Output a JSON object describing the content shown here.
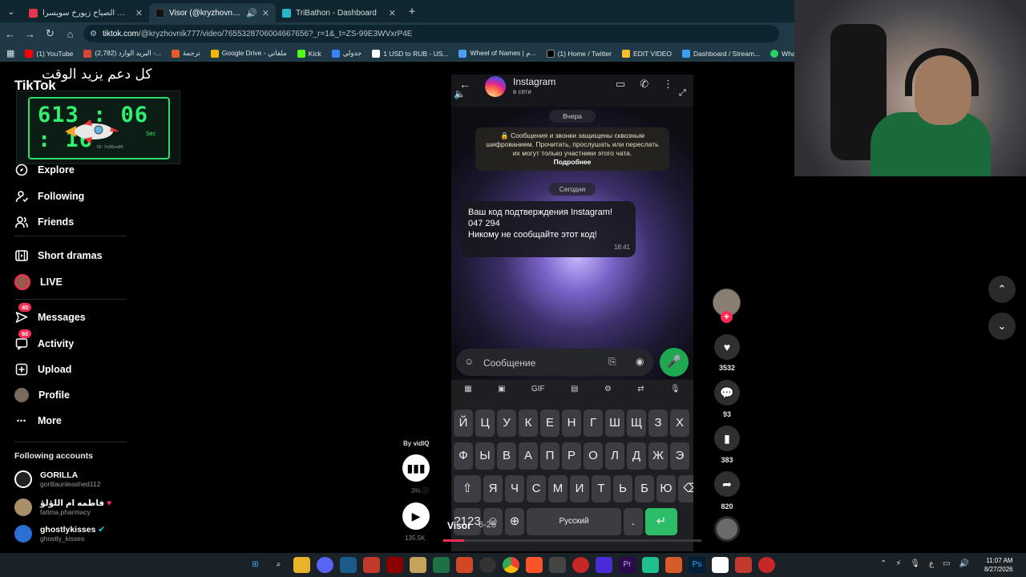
{
  "browser": {
    "tabs": [
      {
        "title": "فيروزيات الصباح زيورخ سويسرا ...",
        "active": false,
        "color": "#e8344e"
      },
      {
        "title": "Visor (@kryzhovnik777)'s vi...",
        "active": true,
        "color": "#111111"
      },
      {
        "title": "TriBathon - Dashboard",
        "active": false,
        "color": "#2ab6c9"
      }
    ],
    "url_host": "tiktok.com",
    "url_path": "/@kryzhovnik777/video/7655328706004667656?_r=1&_t=ZS-99E3WVxrP4E",
    "bookmarks": [
      {
        "label": "(1) YouTube",
        "color": "#ff0000"
      },
      {
        "label": "(2,782) البريد الوارد -...",
        "color": "#d44638"
      },
      {
        "label": "ترجمة",
        "color": "#e85a2a"
      },
      {
        "label": "Google Drive - ملفاتي",
        "color": "#f5b800"
      },
      {
        "label": "Kick",
        "color": "#53fc18"
      },
      {
        "label": "جدولي",
        "color": "#3b82f6"
      },
      {
        "label": "1 USD to RUB - US...",
        "color": "#ffffff"
      },
      {
        "label": "Wheel of Names | م...",
        "color": "#4c9cf1"
      },
      {
        "label": "(1) Home / Twitter",
        "color": "#000000"
      },
      {
        "label": "EDIT VIDEO",
        "color": "#f7c02b"
      },
      {
        "label": "Dashboard / Stream...",
        "color": "#3aa0f0"
      },
      {
        "label": "WhatsApp",
        "color": "#25d366"
      },
      {
        "label": "D",
        "color": "#3a5bd9"
      }
    ]
  },
  "sidebar": {
    "logo": "TikTok",
    "overlay_text": "كل دعم يزيد الوقت",
    "timer": {
      "value": "613 : 06 : 16",
      "sec_label": "Sec",
      "sub": "ID: 7e36ce86",
      "badge": "LIVE"
    },
    "items": [
      {
        "label": "Explore",
        "icon": "compass-icon"
      },
      {
        "label": "Following",
        "icon": "following-icon"
      },
      {
        "label": "Friends",
        "icon": "friends-icon"
      },
      {
        "label": "Short dramas",
        "icon": "film-icon"
      },
      {
        "label": "LIVE",
        "icon": "live-avatar-icon"
      },
      {
        "label": "Messages",
        "icon": "messages-icon",
        "badge": "40"
      },
      {
        "label": "Activity",
        "icon": "activity-icon",
        "badge": "60"
      },
      {
        "label": "Upload",
        "icon": "upload-icon"
      },
      {
        "label": "Profile",
        "icon": "profile-avatar-icon"
      },
      {
        "label": "More",
        "icon": "more-icon"
      }
    ],
    "following_heading": "Following accounts",
    "following": [
      {
        "name": "GORILLA",
        "handle": "gorillaunleashed112"
      },
      {
        "name": "فاطمه ام اللؤلؤ",
        "handle": "fatima.pharmacy"
      },
      {
        "name": "ghostlykisses",
        "handle": "ghostly_kisses"
      }
    ]
  },
  "video": {
    "chat_name": "Instagram",
    "chat_status": "в сети",
    "date_yesterday": "Вчера",
    "encryption_text": "Сообщения и звонки защищены сквозным шифрованием. Прочитать, прослушать или переслать их могут только участники этого чата.",
    "encryption_more": "Подробнее",
    "date_today": "Сегодня",
    "message_line1": "Ваш код подтверждения Instagram!",
    "message_line2": "047 294",
    "message_line3": "Никому не сообщайте этот код!",
    "message_time": "18:41",
    "compose_placeholder": "Сообщение",
    "keyboard_row1": [
      "Й",
      "Ц",
      "У",
      "К",
      "Е",
      "Н",
      "Г",
      "Ш",
      "Щ",
      "З",
      "Х"
    ],
    "keyboard_row2": [
      "Ф",
      "Ы",
      "В",
      "А",
      "П",
      "Р",
      "О",
      "Л",
      "Д",
      "Ж",
      "Э"
    ],
    "keyboard_row3": [
      "Я",
      "Ч",
      "С",
      "М",
      "И",
      "Т",
      "Ь",
      "Б",
      "Ю"
    ],
    "space_label": "Русский",
    "kb_gif": "GIF",
    "title": "Visor",
    "title_suffix": "6-25",
    "progress": 0.08
  },
  "vidiq": {
    "by": "By vidIQ",
    "percent": "3%",
    "count": "135.5K"
  },
  "actions": {
    "likes": "3532",
    "comments": "93",
    "saves": "383",
    "shares": "820"
  },
  "taskbar": {
    "time": "11:07 AM",
    "date": "8/27/2026",
    "lang": "ع"
  }
}
